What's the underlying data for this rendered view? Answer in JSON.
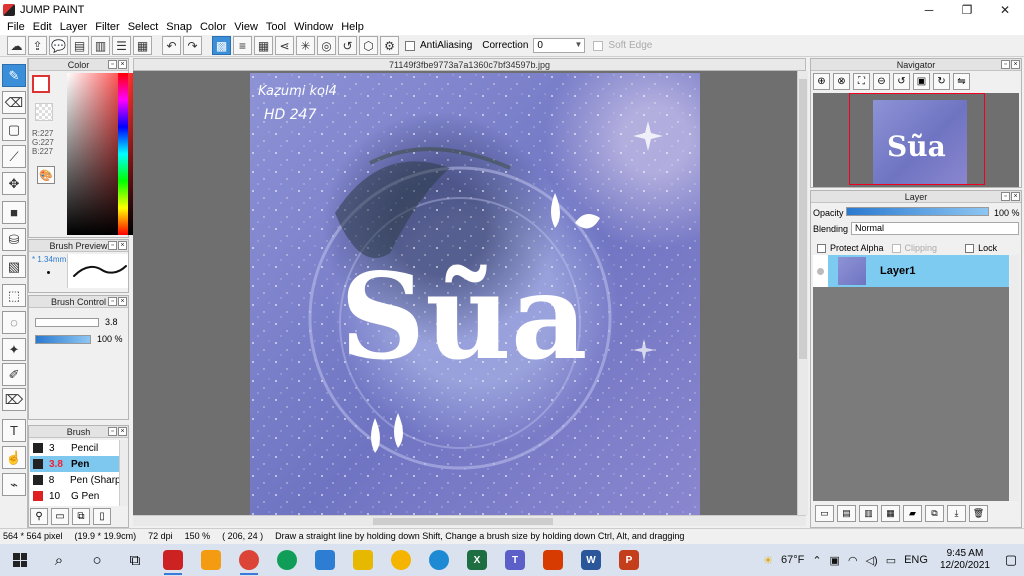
{
  "window": {
    "title": "JUMP PAINT"
  },
  "menu": [
    "File",
    "Edit",
    "Layer",
    "Filter",
    "Select",
    "Snap",
    "Color",
    "View",
    "Tool",
    "Window",
    "Help"
  ],
  "toolbar": {
    "antialiasing_label": "AntiAliasing",
    "correction_label": "Correction",
    "correction_value": "0",
    "soft_edge_label": "Soft Edge"
  },
  "panels": {
    "color": {
      "title": "Color",
      "r": "R:227",
      "g": "G:227",
      "b": "B:227"
    },
    "brush_preview": {
      "title": "Brush Preview",
      "size": "* 1.34mm"
    },
    "brush_control": {
      "title": "Brush Control",
      "size_value": "3.8",
      "opacity_value": "100 %"
    },
    "brush": {
      "title": "Brush",
      "items": [
        {
          "size": "3",
          "name": "Pencil",
          "color": "#222222"
        },
        {
          "size": "3.8",
          "name": "Pen",
          "color": "#222222",
          "selected": true
        },
        {
          "size": "8",
          "name": "Pen (Sharp",
          "color": "#222222"
        },
        {
          "size": "10",
          "name": "G Pen",
          "color": "#e02020"
        }
      ]
    },
    "navigator": {
      "title": "Navigator"
    },
    "layer": {
      "title": "Layer",
      "opacity_label": "Opacity",
      "opacity_value": "100 %",
      "blending_label": "Blending",
      "blending_value": "Normal",
      "protect_alpha_label": "Protect Alpha",
      "clipping_label": "Clipping",
      "lock_label": "Lock",
      "layers": [
        {
          "name": "Layer1"
        }
      ]
    }
  },
  "document": {
    "filename": "71149f3fbe9773a7a1360c7bf34597b.jpg",
    "artwork_text": "Sũa",
    "signature_line1": "Kazumi kol4",
    "signature_line2": "HD 247"
  },
  "status": {
    "size": "564 * 564 pixel",
    "physical": "(19.9 * 19.9cm)",
    "dpi": "72 dpi",
    "zoom": "150 %",
    "coords": "( 206, 24 )",
    "hint": "Draw a straight line by holding down Shift, Change a brush size by holding down Ctrl, Alt, and dragging"
  },
  "taskbar": {
    "weather": "67°F",
    "language": "ENG",
    "time": "9:45 AM",
    "date": "12/20/2021"
  },
  "colors": {
    "accent": "#3b8fd9",
    "layer_selected": "#7ecbf2",
    "canvas_bg": "#6f6f6f"
  }
}
